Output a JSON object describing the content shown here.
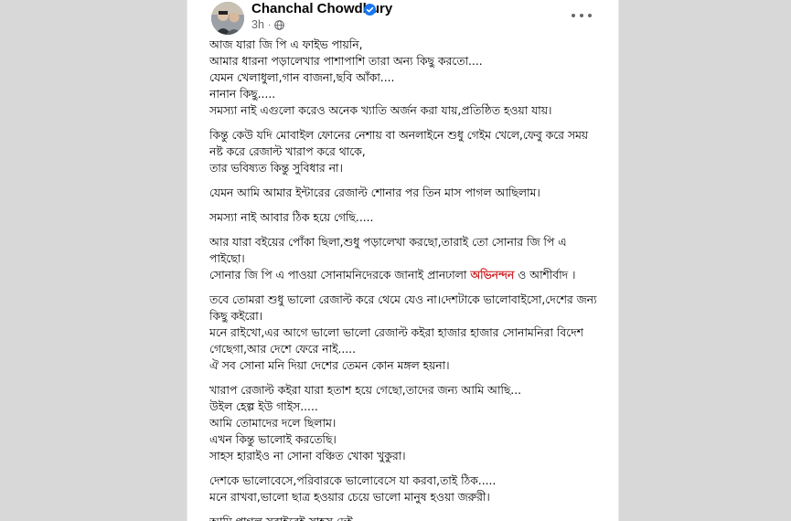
{
  "post": {
    "author": "Chanchal Chowdhury",
    "time": "3h",
    "paragraphs": [
      [
        "আজ যারা জি পি এ ফাইভ পায়নি,",
        "আমার ধারনা পড়ালেখার পাশাপাশি তারা অন্য কিছু করতো....",
        "যেমন খেলাধুলা,গান বাজনা,ছবি আঁকা....",
        "নানান কিছু.....",
        "সমস্যা নাই এগুলো করেও অনেক খ্যাতি অর্জন করা যায়,প্রতিষ্ঠিত হওয়া যায়।"
      ],
      [
        "কিন্তু কেউ যদি মোবাইল ফোনের নেশায় বা অনলাইনে শুধু গেইম খেলে,ফেবু করে সময়",
        "নষ্ট করে রেজাল্ট খারাপ করে থাকে,",
        "তার ভবিষ্যত কিন্তু সুবিধার না।"
      ],
      [
        "যেমন আমি আমার ইন্টারের রেজাল্ট শোনার পর তিন মাস পাগল আছিলাম।"
      ],
      [
        "সমস্যা নাই আবার ঠিক হয়ে গেছি....."
      ],
      [
        "আর যারা বইয়ের পোঁকা ছিলা,শুধু পড়ালেখা করছো,তারাই তো সোনার জি পি এ",
        "পাইছো।"
      ],
      [
        "তবে তোমরা শুধু ভালো রেজাল্ট করে থেমে যেও না।দেশটাকে ভালোবাইসো,দেশের জন্য",
        "কিছু কইরো।",
        "মনে রাইখো,এর আগে ভালো ভালো রেজাল্ট কইরা হাজার হাজার সোনামনিরা বিদেশ",
        "গেছেগা,আর দেশে ফেরে নাই.....",
        "ঐ সব সোনা মনি দিয়া দেশের তেমন কোন মঙ্গল হয়না।"
      ],
      [
        "খারাপ রেজাল্ট কইরা যারা হতাশ হয়ে গেছো,তাদের জন্য আমি আছি...",
        "উইল হেল্প ইউ গাইস.....",
        "আমি তোমাদের দলে ছিলাম।",
        "এখন কিন্তু ভালোই করতেছি।",
        "সাহস হারাইও না সোনা বঞ্চিত খোকা খুকুরা।"
      ],
      [
        "দেশকে ভালোবেসে,পরিবারকে ভালোবেসে যা করবা,তাই ঠিক.....",
        "মনে রাখবা,ভালো ছাত্র হওয়ার চেয়ে ভালো মানুষ হওয়া জরুরী।"
      ],
      [
        "আমি পাগল সবাইরেই সাহস দেই..."
      ]
    ],
    "congrats": {
      "before": "সোনার জি পি এ পাওয়া সোনামনিদেরকে জানাই প্রানঢালা ",
      "highlight": "অভিনন্দন",
      "after": " ও আশীর্বাদ ।"
    }
  },
  "colors": {
    "background": "#d8d8d8",
    "card": "#ffffff",
    "text": "#050505",
    "meta": "#65676b",
    "verified": "#1877f2",
    "highlight": "#d02428"
  }
}
